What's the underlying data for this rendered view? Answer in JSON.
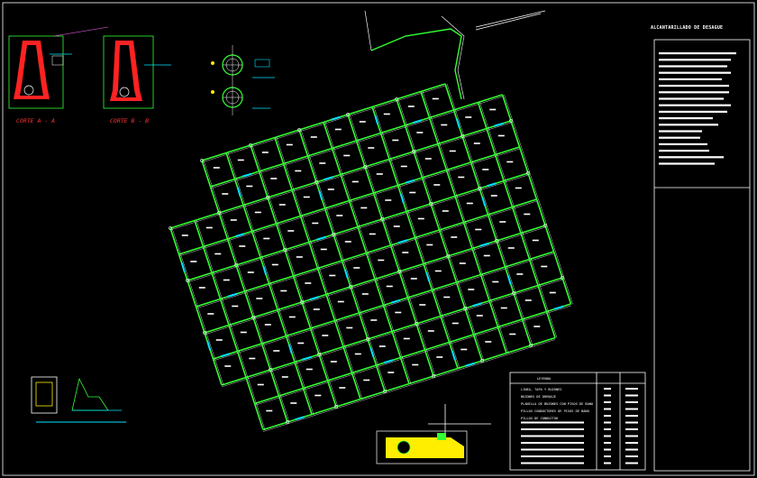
{
  "drawing": {
    "title_block_heading": "ALCANTARILLADO DE DESAGUE",
    "section_a_label": "CORTE A - A",
    "section_b_label": "CORTE B - B",
    "legend": {
      "title": "LEYENDA",
      "rows": [
        "LINEA, TAPA Y BUZONES",
        "BUZONES DE DRENAJE",
        "PLANILLA DE BUZONES CON PISOS DE BANO",
        "PILLOS CONDUCTORES DE PISOS DE BANO",
        "PILLOS DE CONDUCTOR"
      ]
    },
    "colors": {
      "background": "#000000",
      "grid_lines": "#33ff33",
      "pipe_accent": "#00e5ff",
      "section_fill": "#ff2222",
      "annotation": "#ffffff",
      "ground_fill": "#ffee00"
    }
  }
}
